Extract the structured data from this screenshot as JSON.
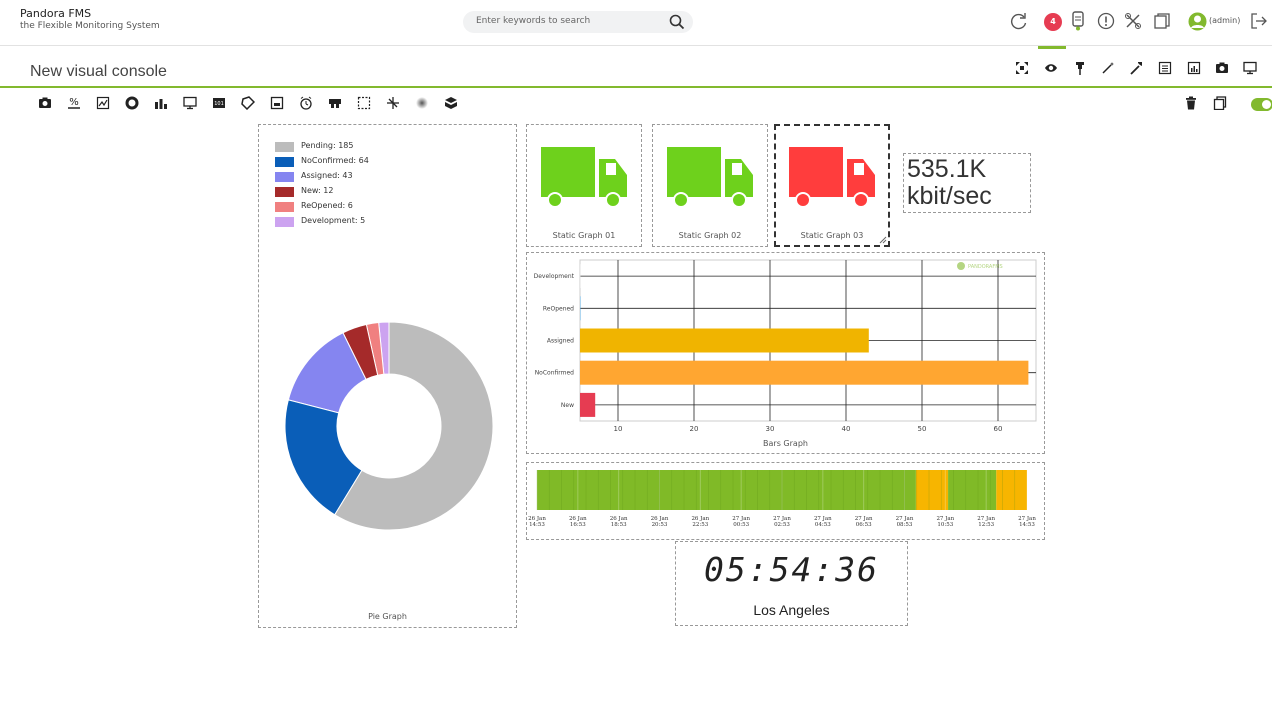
{
  "app": {
    "title": "Pandora FMS",
    "subtitle": "the Flexible Monitoring System"
  },
  "search": {
    "placeholder": "Enter keywords to search"
  },
  "header": {
    "notifications_count": "4",
    "user_label": "(admin)"
  },
  "page": {
    "title": "New visual console"
  },
  "view_tabs": [
    "fullscreen-icon",
    "eye-icon",
    "pin-icon",
    "wand-icon",
    "wrench-icon",
    "list-icon",
    "chart-icon",
    "camera-icon",
    "monitor-icon"
  ],
  "editor_toolbar": {
    "items": [
      "static-image-icon",
      "percentile-icon",
      "module-graph-icon",
      "donut-icon",
      "bar-graph-icon",
      "net-graph-icon",
      "digital-value-icon",
      "label-icon",
      "icon-element-icon",
      "clock-icon",
      "group-icon",
      "box-icon",
      "line-icon",
      "color-cloud-icon",
      "service-icon"
    ],
    "right": [
      "trash-icon",
      "copy-icon",
      "toggle-switch"
    ]
  },
  "colors": {
    "accent": "#82b92e",
    "badge": "#e63c52",
    "truck_green": "#6ed11c",
    "truck_red": "#ff3d3d"
  },
  "pie_graph": {
    "label": "Pie Graph",
    "legend": [
      {
        "text": "Pending: 185",
        "color": "#bcbcbc"
      },
      {
        "text": "NoConfirmed: 64",
        "color": "#0a5eb8"
      },
      {
        "text": "Assigned: 43",
        "color": "#8585f0"
      },
      {
        "text": "New: 12",
        "color": "#a52a2a"
      },
      {
        "text": "ReOpened: 6",
        "color": "#f08080"
      },
      {
        "text": "Development: 5",
        "color": "#cca3f0"
      }
    ],
    "chart_data": {
      "type": "pie",
      "categories": [
        "Pending",
        "NoConfirmed",
        "Assigned",
        "New",
        "ReOpened",
        "Development"
      ],
      "values": [
        185,
        64,
        43,
        12,
        6,
        5
      ]
    }
  },
  "static_graphs": [
    {
      "label": "Static Graph 01",
      "status": "green"
    },
    {
      "label": "Static Graph 02",
      "status": "green"
    },
    {
      "label": "Static Graph 03",
      "status": "red"
    }
  ],
  "value_item": {
    "line1": "535.1K",
    "line2": "kbit/sec"
  },
  "bars_graph": {
    "label": "Bars Graph",
    "watermark": "PANDORAFMS",
    "chart_data": {
      "type": "bar",
      "categories": [
        "Development",
        "ReOpened",
        "Assigned",
        "NoConfirmed",
        "New"
      ],
      "values": [
        0,
        1,
        43,
        64,
        7
      ],
      "colors": [
        "#e0e0e0",
        "#5dade2",
        "#f0b400",
        "#ffa631",
        "#e63c52"
      ],
      "xlim": [
        5,
        65
      ],
      "xticks": [
        10,
        20,
        30,
        40,
        50,
        60
      ]
    }
  },
  "module_graph": {
    "ticks": [
      {
        "d": "26 Jan",
        "t": "14:53"
      },
      {
        "d": "26 Jan",
        "t": "16:53"
      },
      {
        "d": "26 Jan",
        "t": "18:53"
      },
      {
        "d": "26 Jan",
        "t": "20:53"
      },
      {
        "d": "26 Jan",
        "t": "22:53"
      },
      {
        "d": "27 Jan",
        "t": "00:53"
      },
      {
        "d": "27 Jan",
        "t": "02:53"
      },
      {
        "d": "27 Jan",
        "t": "04:53"
      },
      {
        "d": "27 Jan",
        "t": "06:53"
      },
      {
        "d": "27 Jan",
        "t": "08:53"
      },
      {
        "d": "27 Jan",
        "t": "10:53"
      },
      {
        "d": "27 Jan",
        "t": "12:53"
      },
      {
        "d": "27 Jan",
        "t": "14:53"
      }
    ],
    "segments": [
      {
        "color": "#80ba27",
        "w": 0.7733
      },
      {
        "color": "#f7b500",
        "w": 0.0656
      },
      {
        "color": "#80ba27",
        "w": 0.0984
      },
      {
        "color": "#f7b500",
        "w": 0.0627
      }
    ]
  },
  "clock": {
    "time": "05:54:36",
    "city": "Los Angeles"
  }
}
